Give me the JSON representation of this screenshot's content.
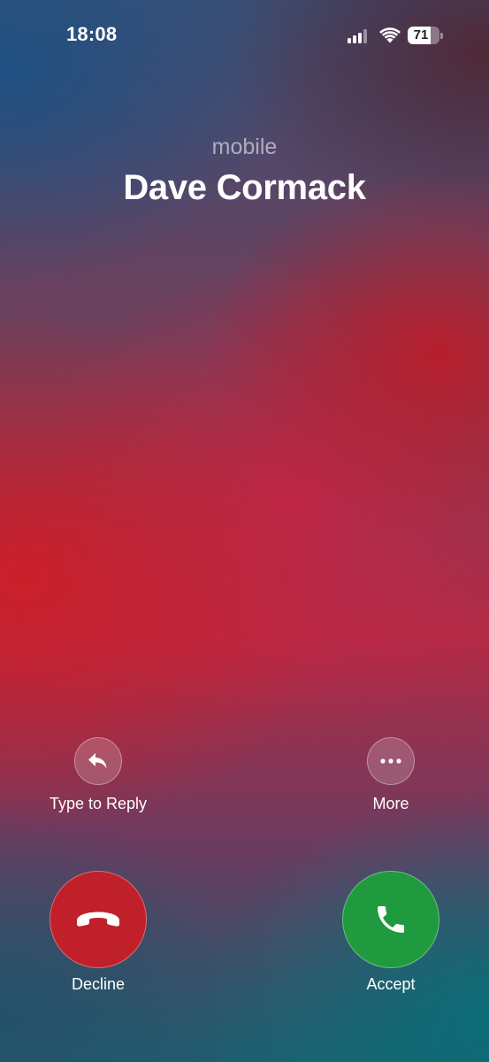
{
  "status_bar": {
    "time": "18:08",
    "battery_level": "71",
    "battery_fraction": 0.71,
    "icons": [
      "signal-icon",
      "wifi-icon",
      "battery-icon"
    ]
  },
  "call": {
    "label": "mobile",
    "caller_name": "Dave Cormack"
  },
  "actions": {
    "reply_label": "Type to Reply",
    "more_label": "More"
  },
  "buttons": {
    "decline_label": "Decline",
    "accept_label": "Accept"
  },
  "colors": {
    "decline": "#c0202a",
    "accept": "#1f9a3e"
  }
}
